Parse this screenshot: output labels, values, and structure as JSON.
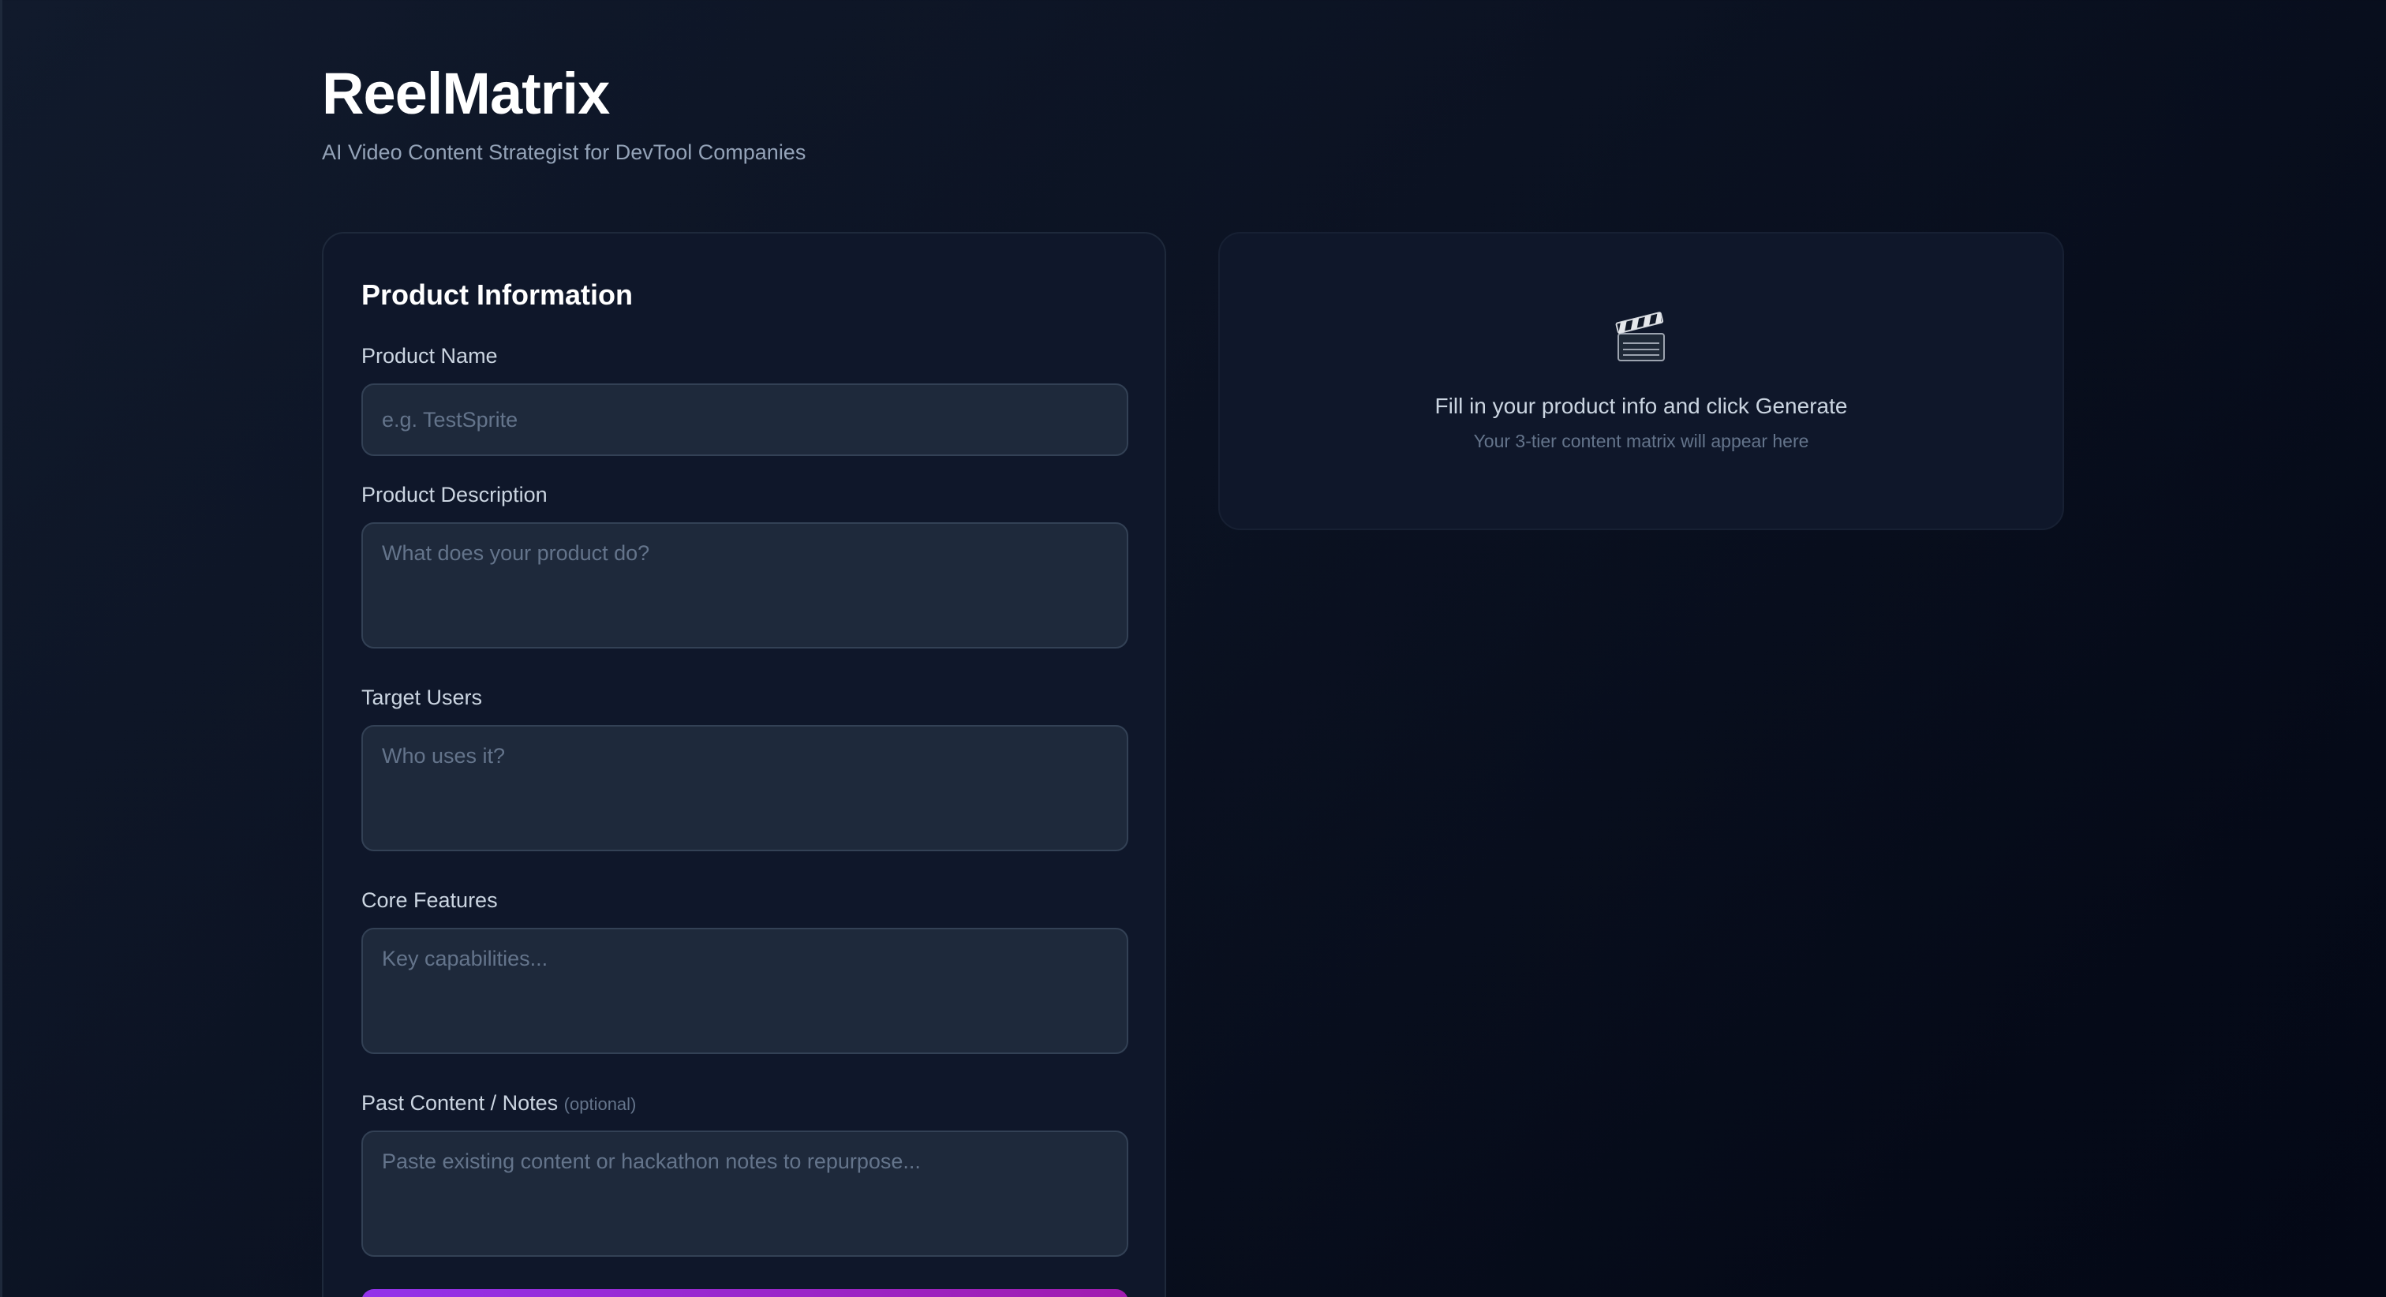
{
  "app": {
    "title": "ReelMatrix",
    "subtitle": "AI Video Content Strategist for DevTool Companies"
  },
  "form": {
    "title": "Product Information",
    "fields": [
      {
        "label": "Product Name",
        "placeholder": "e.g. TestSprite",
        "value": ""
      },
      {
        "label": "Product Description",
        "placeholder": "What does your product do?",
        "value": ""
      },
      {
        "label": "Target Users",
        "placeholder": "Who uses it?",
        "value": ""
      },
      {
        "label": "Core Features",
        "placeholder": "Key capabilities...",
        "value": ""
      },
      {
        "label": "Past Content / Notes",
        "optional_tag": "(optional)",
        "placeholder": "Paste existing content or hackathon notes to repurpose...",
        "value": ""
      }
    ],
    "generate_button_color": "#9333ea"
  },
  "results": {
    "empty_icon": "clapper-board-icon",
    "empty_title": "Fill in your product info and click Generate",
    "empty_subtitle": "Your 3-tier content matrix will appear here"
  },
  "colors": {
    "background": "#0b1222",
    "card": "#0f172a",
    "input": "#1e293b",
    "accent": "#9333ea"
  }
}
